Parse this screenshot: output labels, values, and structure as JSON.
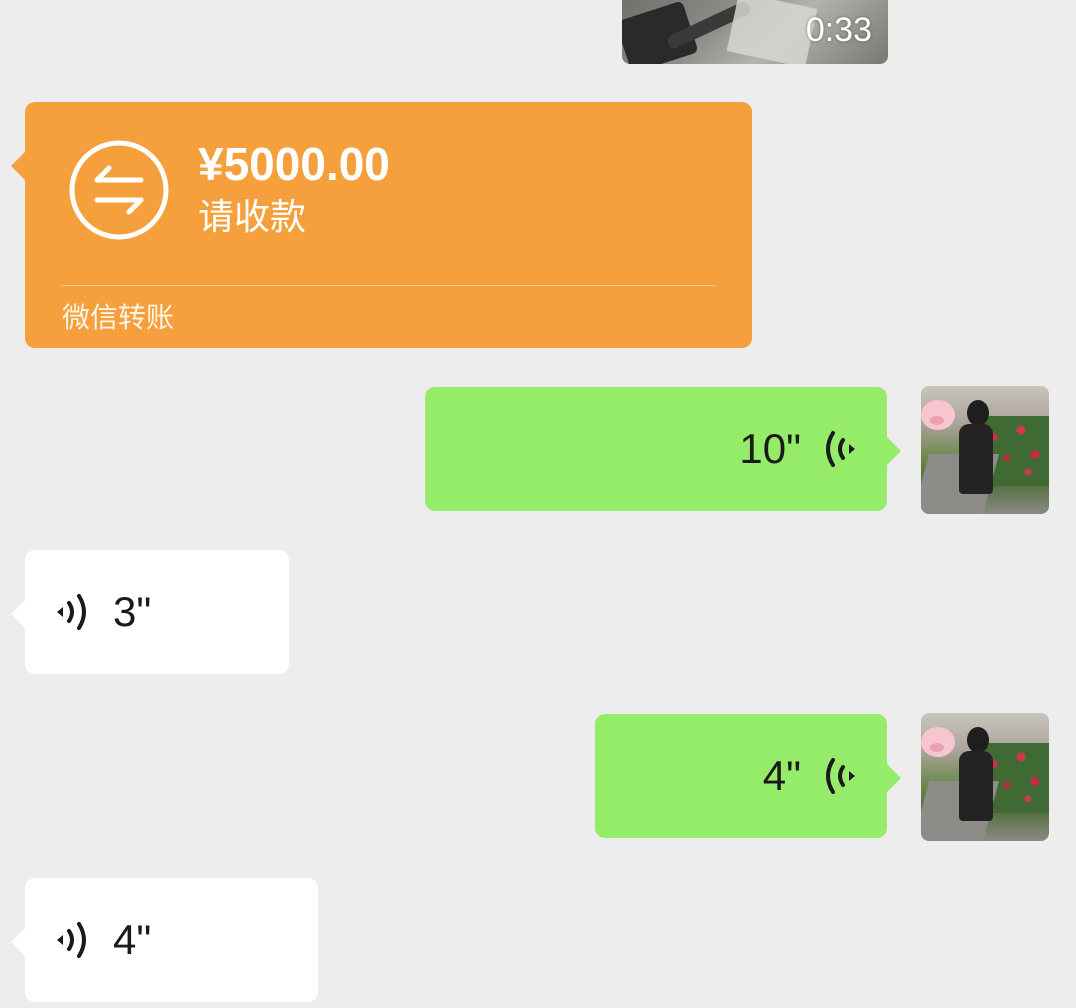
{
  "video": {
    "duration": "0:33"
  },
  "transfer": {
    "amount": "¥5000.00",
    "status": "请收款",
    "footer": "微信转账",
    "icon": "transfer-arrows-icon",
    "color": "#f5a03c"
  },
  "messages": [
    {
      "direction": "sent",
      "type": "voice",
      "duration": "10\""
    },
    {
      "direction": "received",
      "type": "voice",
      "duration": "3\""
    },
    {
      "direction": "sent",
      "type": "voice",
      "duration": "4\""
    },
    {
      "direction": "received",
      "type": "voice",
      "duration": "4\""
    }
  ],
  "colors": {
    "background": "#ededed",
    "sent_bubble": "#95ec69",
    "received_bubble": "#ffffff"
  },
  "icons": {
    "voice": "voice-wave-icon",
    "avatar": "user-avatar"
  }
}
